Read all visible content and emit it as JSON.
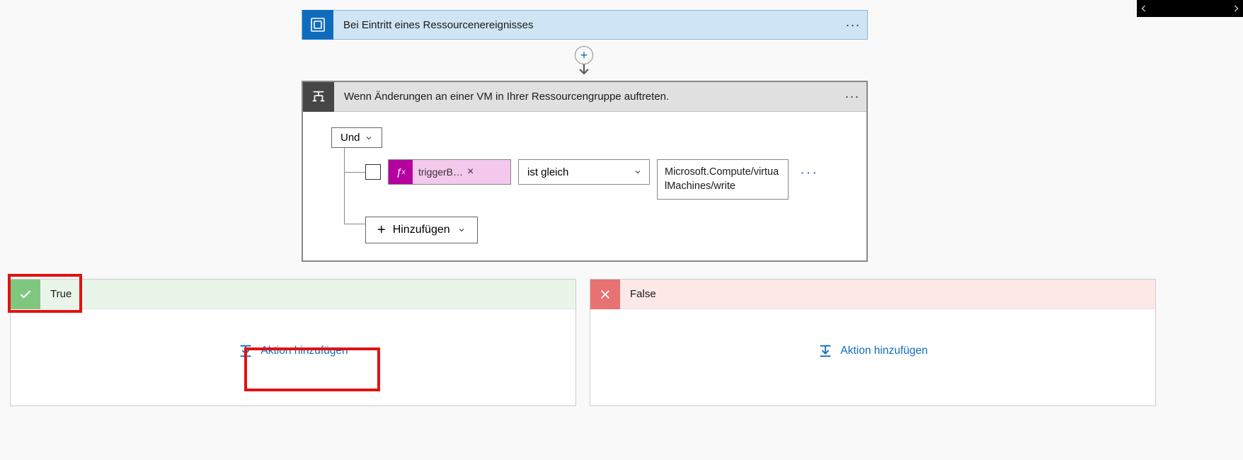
{
  "trigger": {
    "title": "Bei Eintritt eines Ressourcenereignisses"
  },
  "condition": {
    "title": "Wenn Änderungen an einer VM in Ihrer Ressourcengruppe auftreten.",
    "group_operator": "Und",
    "rows": [
      {
        "left_token": "triggerB…",
        "operator": "ist gleich",
        "right_value": "Microsoft.Compute/virtualMachines/write"
      }
    ],
    "add_label": "Hinzufügen"
  },
  "branches": {
    "true_label": "True",
    "false_label": "False",
    "add_action_label": "Aktion hinzufügen"
  }
}
